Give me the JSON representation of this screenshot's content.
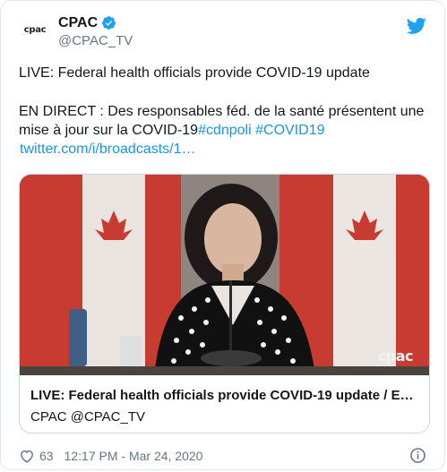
{
  "tweet": {
    "author_name": "CPAC",
    "author_handle": "@CPAC_TV",
    "avatar_text": "cpac",
    "text_line_1": "LIVE: Federal health officials provide COVID-19 update",
    "text_line_2_part_1": "EN DIRECT : Des responsables féd. de la santé présentent une mise à jour sur la COVID-19",
    "hashtag_1": "#cdnpoli",
    "hashtag_2": "#COVID19",
    "link_text": "twitter.com/i/broadcasts/1…",
    "likes": "63",
    "timestamp": "12:17 PM - Mar 24, 2020"
  },
  "media_card": {
    "watermark": "cpac",
    "title": "LIVE: Federal health officials provide COVID-19 update / EN DI...",
    "source": "CPAC @CPAC_TV"
  },
  "colors": {
    "link": "#1b95e0",
    "secondary_text": "#657786",
    "twitter_blue": "#1da1f2",
    "flag_red": "#d2372c"
  },
  "icons": [
    "verified-badge-icon",
    "twitter-bird-icon",
    "heart-icon",
    "info-icon"
  ]
}
